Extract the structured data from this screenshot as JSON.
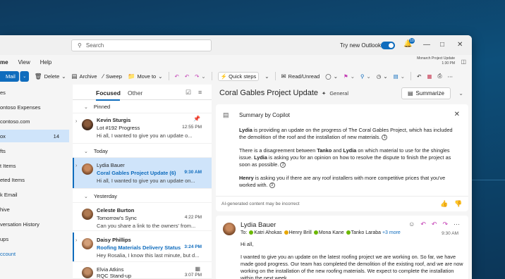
{
  "titlebar": {
    "search_placeholder": "Search",
    "try_new": "Try new Outlook",
    "notification_count": "10",
    "reminder_line1": "Monarch Project Update",
    "reminder_line2": "1:30 PM"
  },
  "menu": {
    "home": "me",
    "view": "View",
    "help": "Help"
  },
  "ribbon": {
    "new_mail": "Mail",
    "delete": "Delete",
    "archive": "Archive",
    "sweep": "Sweep",
    "move_to": "Move to",
    "quick_steps": "Quick steps",
    "read_unread": "Read/Unread"
  },
  "sidebar": {
    "items": [
      {
        "label": "es",
        "count": ""
      },
      {
        "label": "ontoso Expenses",
        "count": ""
      },
      {
        "label": "contoso.com",
        "count": ""
      },
      {
        "label": "ox",
        "count": "14"
      },
      {
        "label": "fts",
        "count": ""
      },
      {
        "label": "t Items",
        "count": ""
      },
      {
        "label": "eted Items",
        "count": ""
      },
      {
        "label": "k Email",
        "count": ""
      },
      {
        "label": "hive",
        "count": ""
      },
      {
        "label": "versation History",
        "count": ""
      },
      {
        "label": "ups",
        "count": ""
      },
      {
        "label": "ccount",
        "count": ""
      }
    ]
  },
  "list": {
    "tab_focused": "Focused",
    "tab_other": "Other",
    "groups": {
      "pinned": "Pinned",
      "today": "Today",
      "yesterday": "Yesterday"
    },
    "messages": [
      {
        "from": "Kevin Sturgis",
        "subject": "Lot #192 Progress",
        "time": "12:55 PM",
        "preview": "Hi all, I wanted to give you an update o..."
      },
      {
        "from": "Lydia Bauer",
        "subject": "Coral Gables Project Update  (6)",
        "time": "9:30 AM",
        "preview": "Hi all, I wanted to give you an update on..."
      },
      {
        "from": "Celeste Burton",
        "subject": "Tomorrow's Sync",
        "time": "4:22 PM",
        "preview": "Can you share a link to the owners' from..."
      },
      {
        "from": "Daisy Phillips",
        "subject": "Roofing Materials Delivery Status",
        "time": "3:24 PM",
        "preview": "Hey Rosalia, I know this last minute, but d..."
      },
      {
        "from": "Elvia Atkins",
        "subject": "RQC Stand-up",
        "time": "3:07 PM",
        "preview": ""
      }
    ]
  },
  "reading": {
    "title": "Coral Gables Project Update",
    "tag": "General",
    "summarize": "Summarize",
    "copilot": {
      "title": "Summary by Copilot",
      "p1_name": "Lydia",
      "p1_text": " is providing an update on the progress of The Coral Gables Project, which has included the demolition of the roof and the installation of new materials.",
      "p1_cite": "1",
      "p2_a": "There is a disagreement between ",
      "p2_name1": "Tanko",
      "p2_b": " and ",
      "p2_name2": "Lydia",
      "p2_c": " on which material to use for the shingles issue. ",
      "p2_name3": "Lydia",
      "p2_d": " is asking you for an opinion on how to resolve the dispute to finish the project as soon as possible.",
      "p2_cite": "2",
      "p3_name": "Henry",
      "p3_text": " is asking you if there are any roof installers with more competitive prices that you've worked with.",
      "p3_cite": "3",
      "disclaimer": "AI-generated content may be incorrect"
    },
    "mail": {
      "from": "Lydia Bauer",
      "to_label": "To:",
      "recipients": [
        "Katri Ahokas",
        "Henry Brill",
        "Mona Kane",
        "Tanko Laraba"
      ],
      "more": "+3 more",
      "time": "9:30 AM",
      "greeting": "Hi all,",
      "body": "I wanted to give you an update on the latest roofing project we are working on. So far, we have made good progress. Our team has completed the demolition of the existing roof, and we are now working on the installation of the new roofing materials. We expect to complete the installation within the next week."
    }
  }
}
